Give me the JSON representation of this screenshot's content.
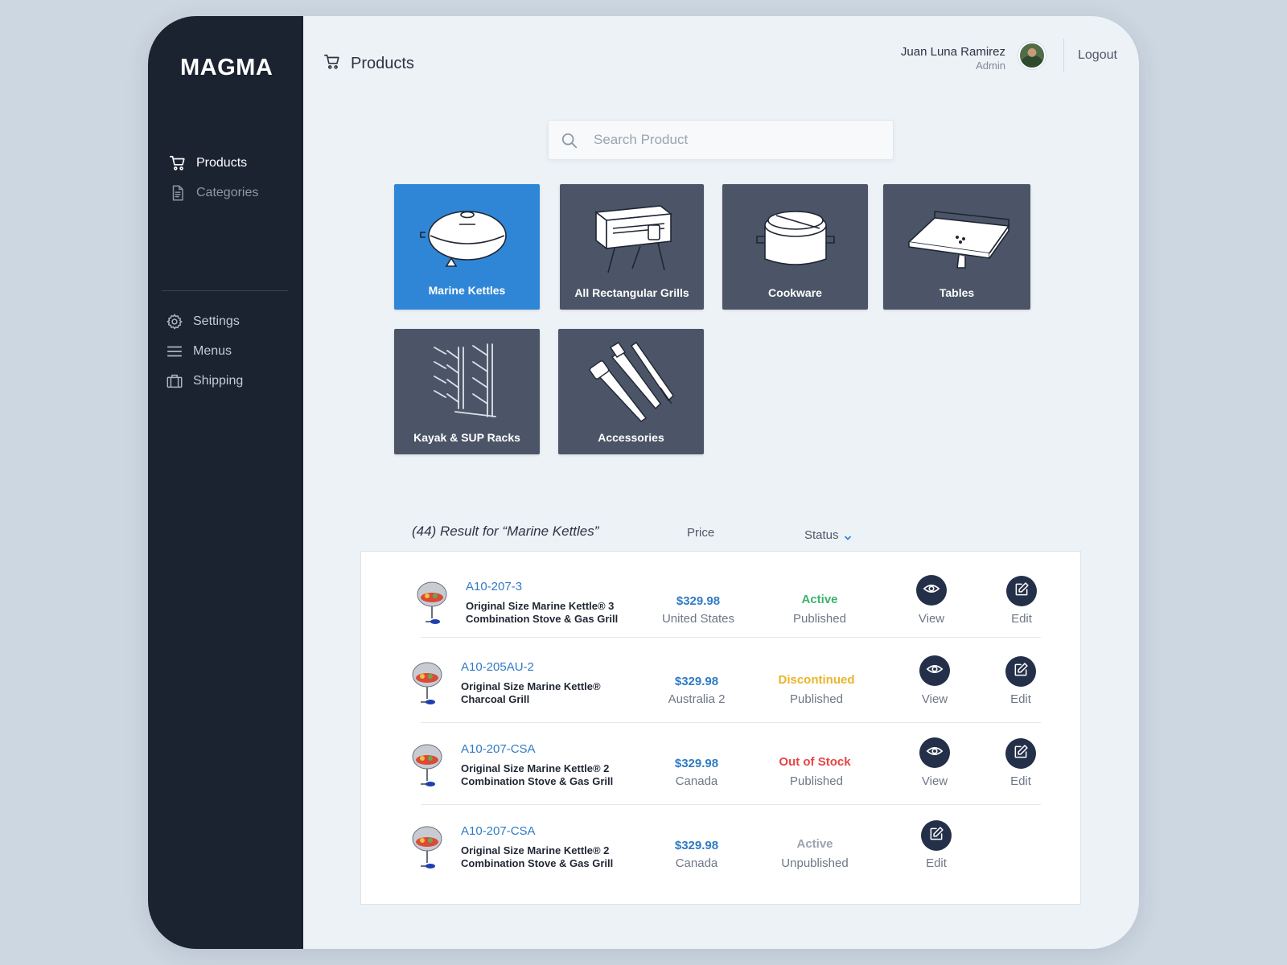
{
  "sidebar": {
    "brand": "MAGMA",
    "items": [
      {
        "label": "Products",
        "icon": "cart-icon",
        "active": true
      },
      {
        "label": "Categories",
        "icon": "document-icon",
        "active": false
      },
      {
        "label": "Settings",
        "icon": "gear-icon",
        "active": false
      },
      {
        "label": "Menus",
        "icon": "menu-icon",
        "active": false
      },
      {
        "label": "Shipping",
        "icon": "briefcase-icon",
        "active": false
      }
    ]
  },
  "header": {
    "title": "Products",
    "user_name": "Juan Luna Ramirez",
    "user_role": "Admin",
    "logout_label": "Logout"
  },
  "search": {
    "placeholder": "Search Product",
    "value": ""
  },
  "categories": [
    {
      "label": "Marine Kettles",
      "selected": true
    },
    {
      "label": "All Rectangular Grills",
      "selected": false
    },
    {
      "label": "Cookware",
      "selected": false
    },
    {
      "label": "Tables",
      "selected": false
    },
    {
      "label": "Kayak & SUP Racks",
      "selected": false
    },
    {
      "label": "Accessories",
      "selected": false
    }
  ],
  "results": {
    "title": "(44) Result for “Marine Kettles”",
    "col_price": "Price",
    "col_status": "Status",
    "rows": [
      {
        "sku": "A10-207-3",
        "name_line1": "Original Size Marine Kettle® 3",
        "name_line2": "Combination Stove & Gas Grill",
        "price": "$329.98",
        "region": "United States",
        "status": "Active",
        "publish": "Published",
        "view_label": "View",
        "edit_label": "Edit"
      },
      {
        "sku": "A10-205AU-2",
        "name_line1": "Original Size Marine Kettle®",
        "name_line2": "Charcoal Grill",
        "price": "$329.98",
        "region": "Australia 2",
        "status": "Discontinued",
        "publish": "Published",
        "view_label": "View",
        "edit_label": "Edit"
      },
      {
        "sku": "A10-207-CSA",
        "name_line1": "Original Size Marine Kettle® 2",
        "name_line2": "Combination Stove & Gas Grill",
        "price": "$329.98",
        "region": "Canada",
        "status": "Out of Stock",
        "publish": "Published",
        "view_label": "View",
        "edit_label": "Edit"
      },
      {
        "sku": "A10-207-CSA",
        "name_line1": "Original Size Marine Kettle® 2",
        "name_line2": "Combination Stove & Gas Grill",
        "price": "$329.98",
        "region": "Canada",
        "status": "Active",
        "publish": "Unpublished",
        "edit_label": "Edit"
      }
    ]
  },
  "colors": {
    "sidebar_bg": "#1b2230",
    "accent_blue": "#2f86d6",
    "tile_bg": "#4b5567",
    "link_blue": "#2f7bc4",
    "status_active": "#3bb36b",
    "status_discontinued": "#e9b52a",
    "status_out_of_stock": "#e54545",
    "status_active_muted": "#9aa3b0",
    "action_button": "#243049"
  }
}
